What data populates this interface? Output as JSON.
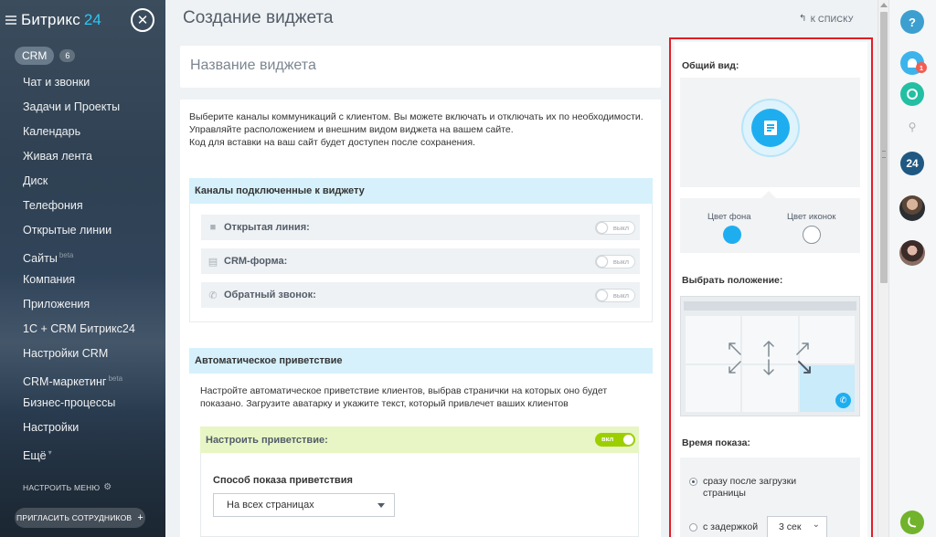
{
  "sidebar": {
    "logo": "Битрикс",
    "logo_num": "24",
    "crm_label": "CRM",
    "crm_count": "6",
    "items": [
      {
        "label": "Чат и звонки"
      },
      {
        "label": "Задачи и Проекты"
      },
      {
        "label": "Календарь"
      },
      {
        "label": "Живая лента"
      },
      {
        "label": "Диск"
      },
      {
        "label": "Телефония"
      },
      {
        "label": "Открытые линии"
      },
      {
        "label": "Сайты",
        "tag": "beta"
      },
      {
        "label": "Компания"
      },
      {
        "label": "Приложения"
      },
      {
        "label": "1С + CRM Битрикс24"
      },
      {
        "label": "Настройки CRM"
      },
      {
        "label": "CRM-маркетинг",
        "tag": "beta"
      },
      {
        "label": "Бизнес-процессы"
      },
      {
        "label": "Настройки"
      },
      {
        "label": "Ещё",
        "tag": "▾"
      }
    ],
    "setup_menu": "НАСТРОИТЬ МЕНЮ",
    "invite": "ПРИГЛАСИТЬ СОТРУДНИКОВ"
  },
  "header": {
    "title": "Создание виджета",
    "back": "К СПИСКУ"
  },
  "name_box": {
    "placeholder": "Название виджета"
  },
  "intro": {
    "line1": "Выберите каналы коммуникаций с клиентом. Вы можете включать и отключать их по необходимости.",
    "line2": "Управляйте расположением и внешним видом виджета на вашем сайте.",
    "line3": "Код для вставки на ваш сайт будет доступен после сохранения."
  },
  "channels": {
    "title": "Каналы подключенные к виджету",
    "items": [
      {
        "label": "Открытая линия:",
        "state": "выкл",
        "icon": "chat-icon"
      },
      {
        "label": "CRM-форма:",
        "state": "выкл",
        "icon": "form-icon"
      },
      {
        "label": "Обратный звонок:",
        "state": "выкл",
        "icon": "phone-icon"
      }
    ]
  },
  "greeting": {
    "title": "Автоматическое приветствие",
    "text": "Настройте автоматическое приветствие клиентов, выбрав странички на которых оно будет показано. Загрузите аватарку и укажите текст, который привлечет ваших клиентов",
    "setup_label": "Настроить приветствие:",
    "setup_state": "вкл",
    "method_label": "Способ показа приветствия",
    "method_value": "На всех страницах"
  },
  "config": {
    "appearance": "Общий вид:",
    "bg_color_label": "Цвет фона",
    "icon_color_label": "Цвет иконок",
    "bg_color": "#1eaef0",
    "icon_color": "#ffffff",
    "position_title": "Выбрать положение:",
    "selected_position": "bottom-right",
    "time_title": "Время показа:",
    "opt_immediate": "сразу после загрузки страницы",
    "opt_delay": "с задержкой",
    "delay_value": "3 сек"
  },
  "rightbar": {
    "help": "?",
    "notif_count": "1",
    "logo_24": "24"
  }
}
